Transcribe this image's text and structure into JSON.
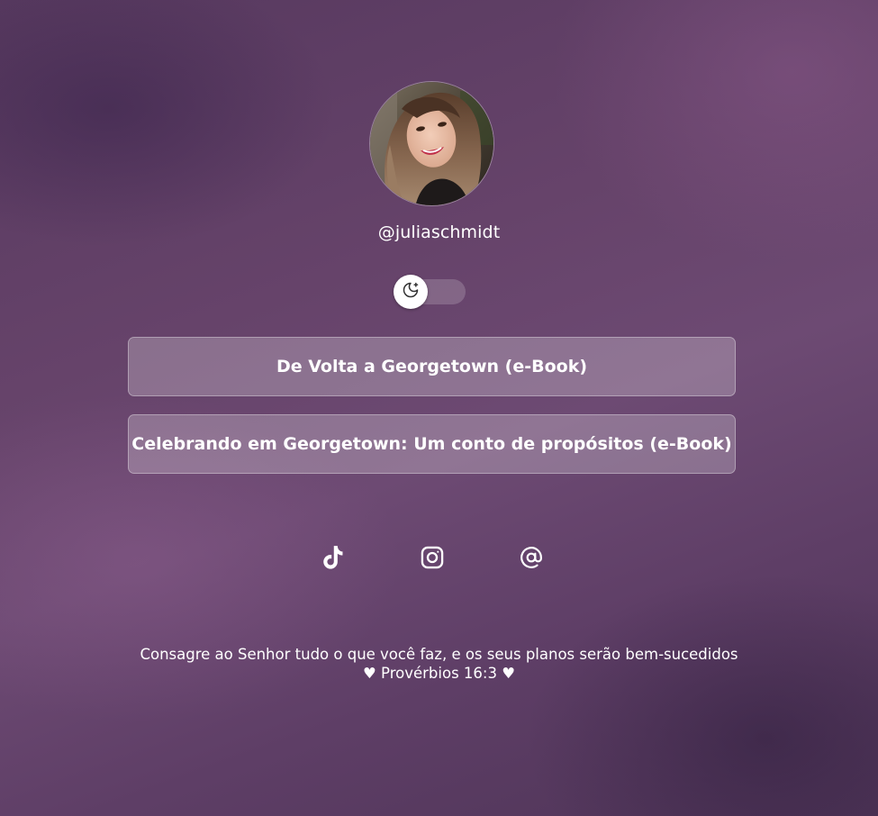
{
  "profile": {
    "username": "@juliaschmidt",
    "avatar_alt": "profile-photo"
  },
  "theme_toggle": {
    "icon": "moon-stars-icon",
    "state": "off"
  },
  "links": [
    {
      "label": "De Volta a Georgetown (e-Book)"
    },
    {
      "label": "Celebrando em Georgetown: Um conto de propósitos (e-Book)"
    }
  ],
  "social": [
    {
      "icon": "tiktok-icon"
    },
    {
      "icon": "instagram-icon"
    },
    {
      "icon": "threads-icon"
    }
  ],
  "footer": {
    "quote_line1": "Consagre ao Senhor tudo o que você faz, e os seus planos serão bem-sucedidos",
    "quote_line2": "♥ Provérbios 16:3 ♥"
  },
  "colors": {
    "background": "#66436a",
    "button_bg": "rgba(255,255,255,0.24)",
    "text": "#ffffff"
  }
}
